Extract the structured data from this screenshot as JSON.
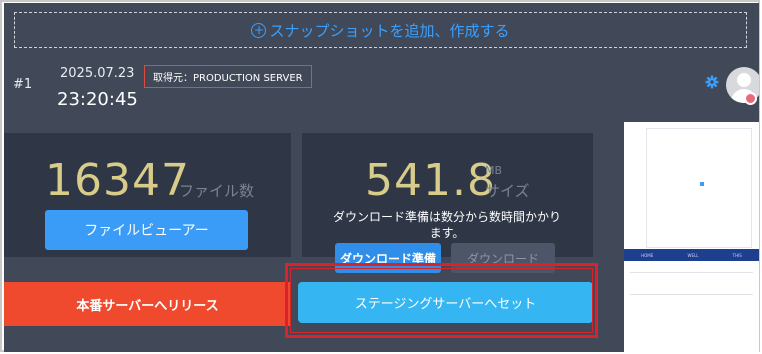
{
  "snapshot_bar": {
    "add_label": "スナップショットを追加、作成する",
    "add_icon": "plus-circle-icon"
  },
  "snapshot": {
    "index": "#1",
    "date": "2025.07.23",
    "time": "23:20:45",
    "source": "取得元：PRODUCTION SERVER"
  },
  "header_icons": {
    "settings": "gear-icon",
    "user": "avatar"
  },
  "files_panel": {
    "count": "16347",
    "unit": "ファイル数",
    "viewer_button": "ファイルビューアー"
  },
  "size_panel": {
    "size": "541.8",
    "size_unit": "MB",
    "size_label": "サイズ",
    "note_line1": "ダウンロード準備は数分から数時間かかり",
    "note_line2": "ます。",
    "prepare_button": "ダウンロード準備",
    "download_button": "ダウンロード"
  },
  "actions": {
    "release_button": "本番サーバーへリリース",
    "staging_button": "ステージングサーバーへセット"
  },
  "thumbnail": {
    "nav_items": [
      "HOME",
      "WELL",
      "THIS"
    ]
  },
  "colors": {
    "accent": "#3aa0ff",
    "number": "#d8cc8a",
    "danger": "#f04a2e",
    "staging": "#35b6f2",
    "highlight": "#d8232a",
    "background": "#414958"
  }
}
